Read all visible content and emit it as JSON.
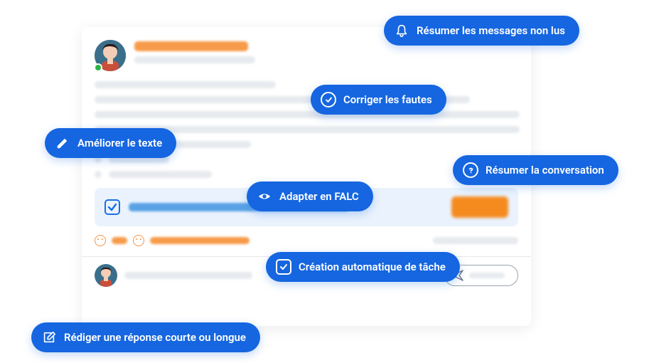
{
  "chips": {
    "summarize_unread": "Résumer les messages non lus",
    "fix_mistakes": "Corriger les fautes",
    "improve_text": "Améliorer le texte",
    "summarize_convo": "Résumer la conversation",
    "adapt_falc": "Adapter en FALC",
    "auto_task": "Création automatique de tâche",
    "draft_reply": "Rédiger une réponse courte ou longue"
  }
}
